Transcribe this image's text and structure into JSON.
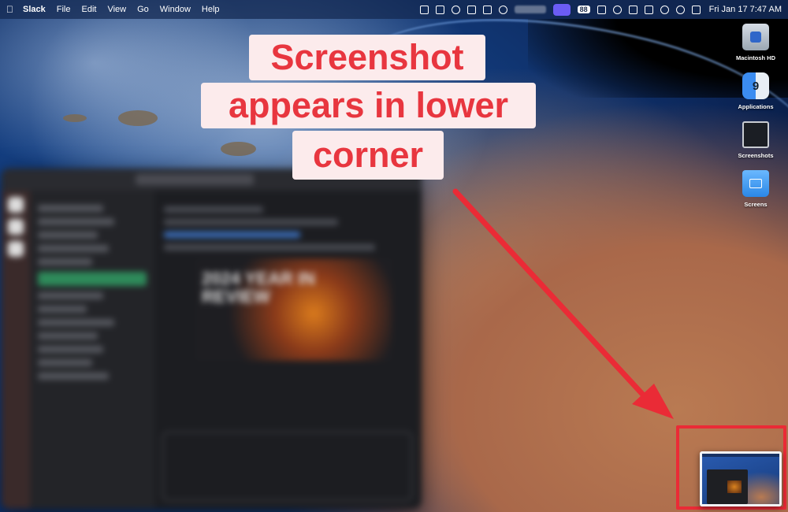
{
  "menubar": {
    "app_name": "Slack",
    "menus": [
      "File",
      "Edit",
      "View",
      "Go",
      "Window",
      "Help"
    ],
    "status_pill": "88",
    "datetime": "Fri Jan 17  7:47 AM"
  },
  "desktop_icons": [
    {
      "label": "Macintosh HD",
      "icon": "hard-drive-icon"
    },
    {
      "label": "Applications",
      "icon": "finder-icon"
    },
    {
      "label": "Screenshots",
      "icon": "screenshot-file-icon"
    },
    {
      "label": "Screens",
      "icon": "folder-icon"
    }
  ],
  "annotation": {
    "line1": "Screenshot",
    "line2": "appears in lower",
    "line3": "corner",
    "color": "#e8363f",
    "background": "#fcebec"
  },
  "slack_window": {
    "card_text": "2024 YEAR IN REVIEW"
  },
  "highlight_color": "#ea2b36"
}
